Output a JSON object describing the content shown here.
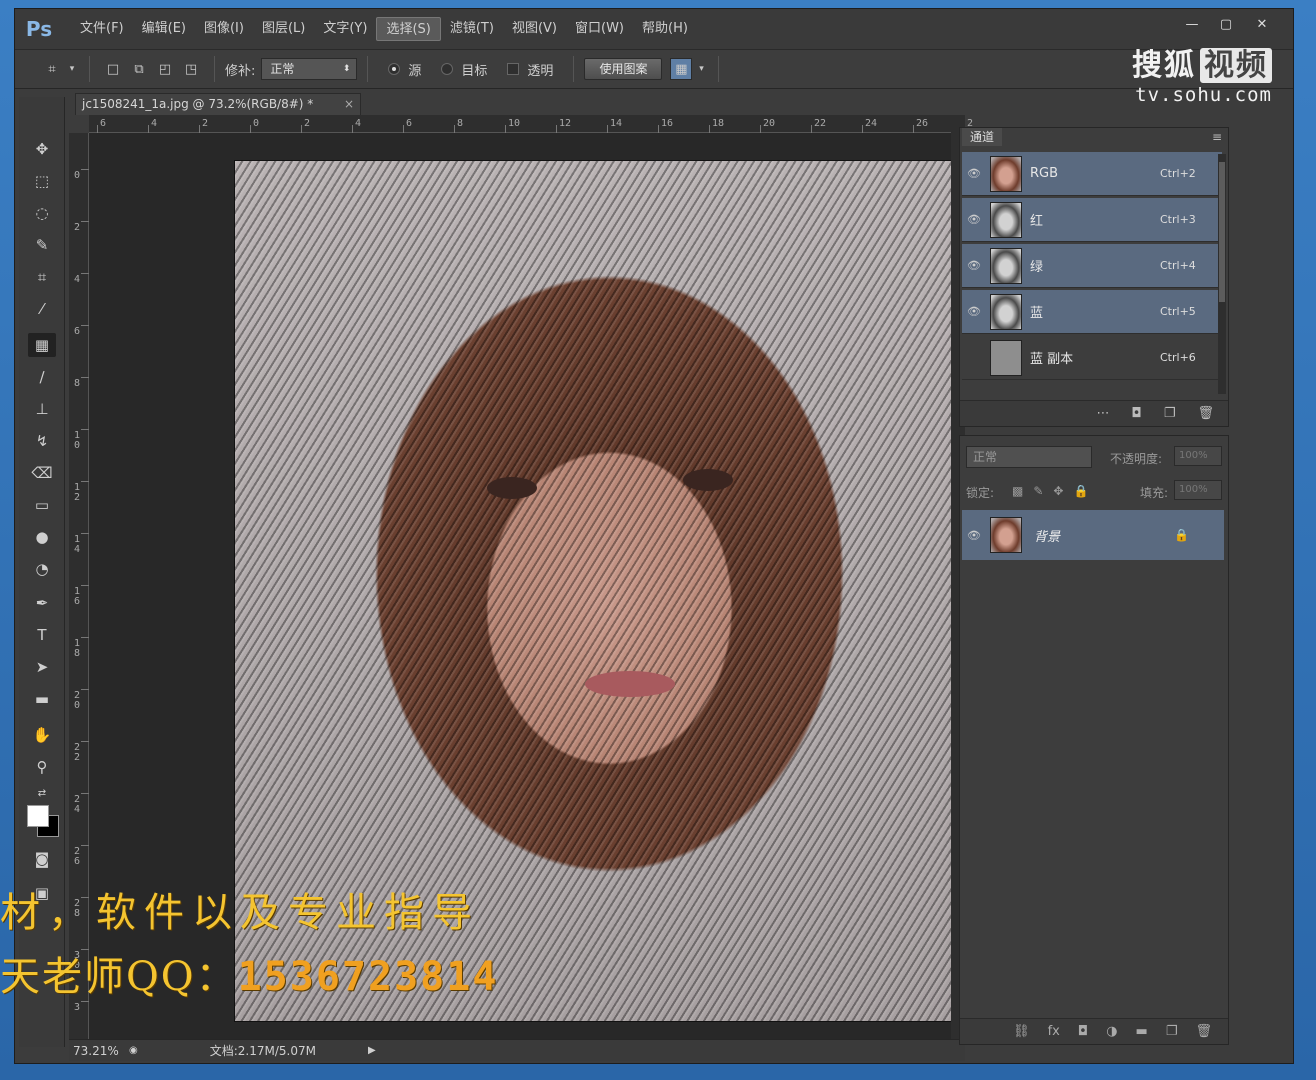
{
  "app": {
    "logo": "Ps"
  },
  "menu": [
    "文件(F)",
    "编辑(E)",
    "图像(I)",
    "图层(L)",
    "文字(Y)",
    "选择(S)",
    "滤镜(T)",
    "视图(V)",
    "窗口(W)",
    "帮助(H)"
  ],
  "menu_active_index": 5,
  "options": {
    "patch_label": "修补:",
    "patch_mode": "正常",
    "source_label": "源",
    "target_label": "目标",
    "transparent_label": "透明",
    "use_pattern_button": "使用图案"
  },
  "watermark": {
    "logo_text": "搜狐",
    "logo_box": "视频",
    "url": "tv.sohu.com"
  },
  "document": {
    "tab_title": "jc1508241_1a.jpg @ 73.2%(RGB/8#) *"
  },
  "ruler_top": [
    "6",
    "4",
    "2",
    "0",
    "2",
    "4",
    "6",
    "8",
    "10",
    "12",
    "14",
    "16",
    "18",
    "20",
    "22",
    "24",
    "26",
    "2"
  ],
  "ruler_left": [
    "0",
    "2",
    "4",
    "6",
    "8",
    "1\n0",
    "1\n2",
    "1\n4",
    "1\n6",
    "1\n8",
    "2\n0",
    "2\n2",
    "2\n4",
    "2\n6",
    "2\n8",
    "3\n0",
    "3"
  ],
  "status": {
    "zoom": "73.21%",
    "doc_size": "文档:2.17M/5.07M"
  },
  "promo": {
    "line1": "材，软件以及专业指导",
    "line2_prefix": "天老师QQ：",
    "line2_qq": "1536723814"
  },
  "channels_panel": {
    "tab": "通道",
    "rows": [
      {
        "name": "RGB",
        "shortcut": "Ctrl+2",
        "thumb": "color",
        "visible": true,
        "selected": true
      },
      {
        "name": "红",
        "shortcut": "Ctrl+3",
        "thumb": "gray",
        "visible": true,
        "selected": true
      },
      {
        "name": "绿",
        "shortcut": "Ctrl+4",
        "thumb": "gray",
        "visible": true,
        "selected": true
      },
      {
        "name": "蓝",
        "shortcut": "Ctrl+5",
        "thumb": "gray",
        "visible": true,
        "selected": true
      },
      {
        "name": "蓝 副本",
        "shortcut": "Ctrl+6",
        "thumb": "flat",
        "visible": false,
        "selected": false
      }
    ]
  },
  "layers_panel": {
    "blend_mode": "正常",
    "opacity_label": "不透明度:",
    "opacity_value": "100%",
    "lock_label": "锁定:",
    "fill_label": "填充:",
    "fill_value": "100%",
    "layer_name": "背景"
  }
}
